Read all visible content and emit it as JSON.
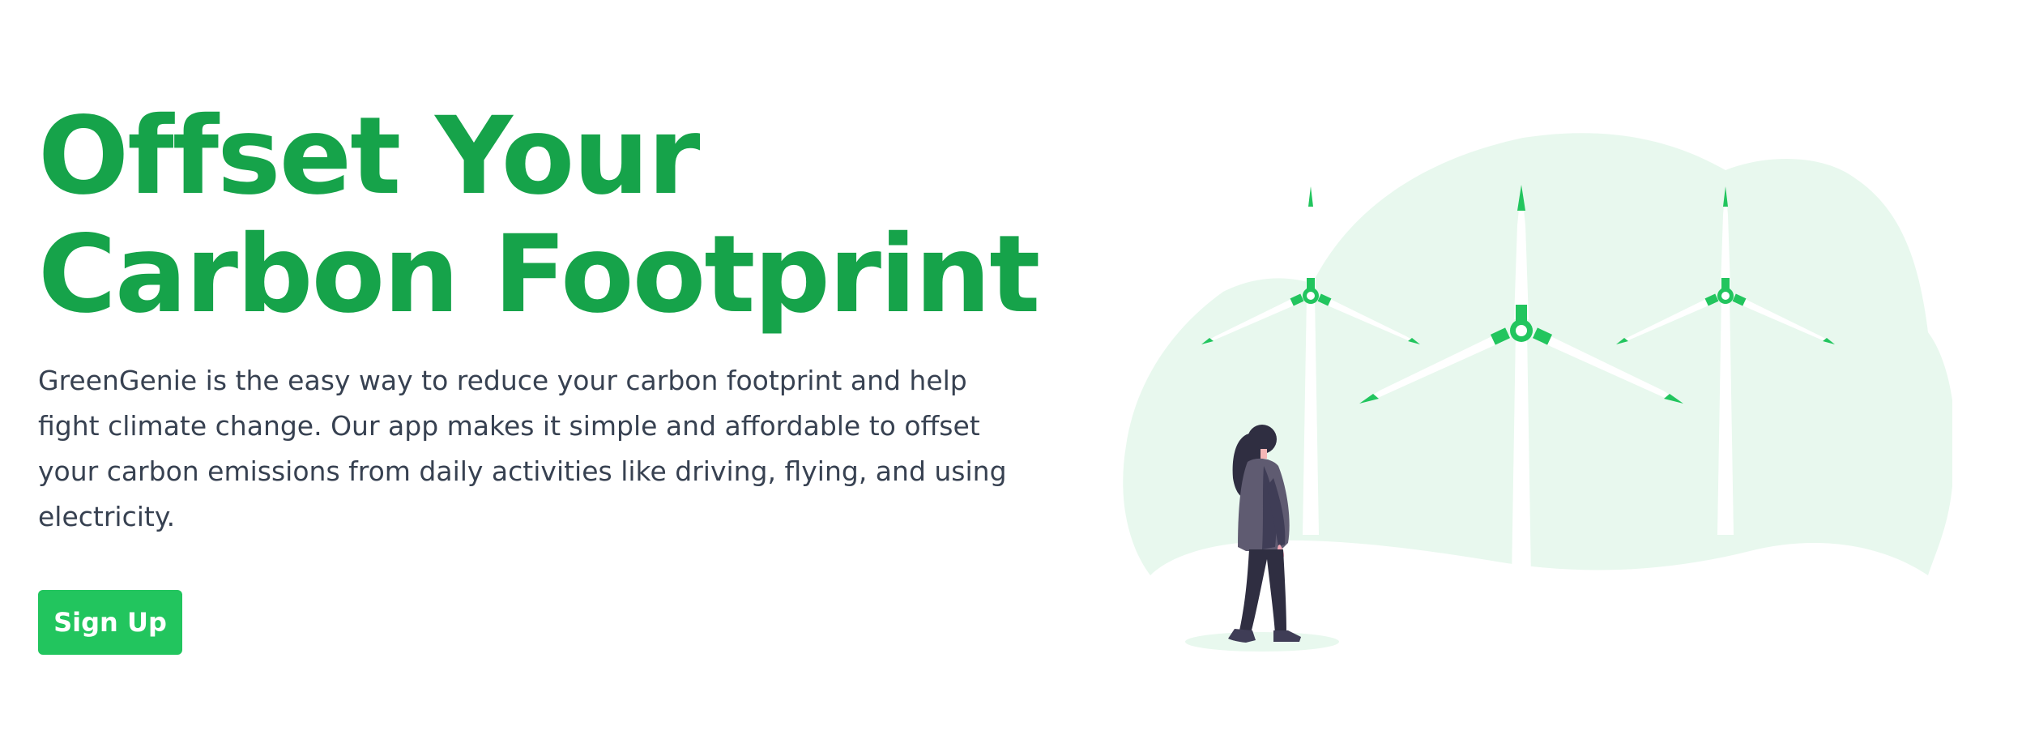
{
  "hero": {
    "title_line1": "Offset Your",
    "title_line2": "Carbon Footprint",
    "description": "GreenGenie is the easy way to reduce your carbon footprint and help fight climate change. Our app makes it simple and affordable to offset your carbon emissions from daily activities like driving, flying, and using electricity.",
    "signup_label": "Sign Up"
  },
  "colors": {
    "brand_green": "#16a34a",
    "button_green": "#22c55e",
    "illustration_bg": "#e8f8ee",
    "body_text": "#374151"
  },
  "illustration": {
    "icons": [
      "wind-turbine-icon",
      "person-walking-icon"
    ]
  }
}
